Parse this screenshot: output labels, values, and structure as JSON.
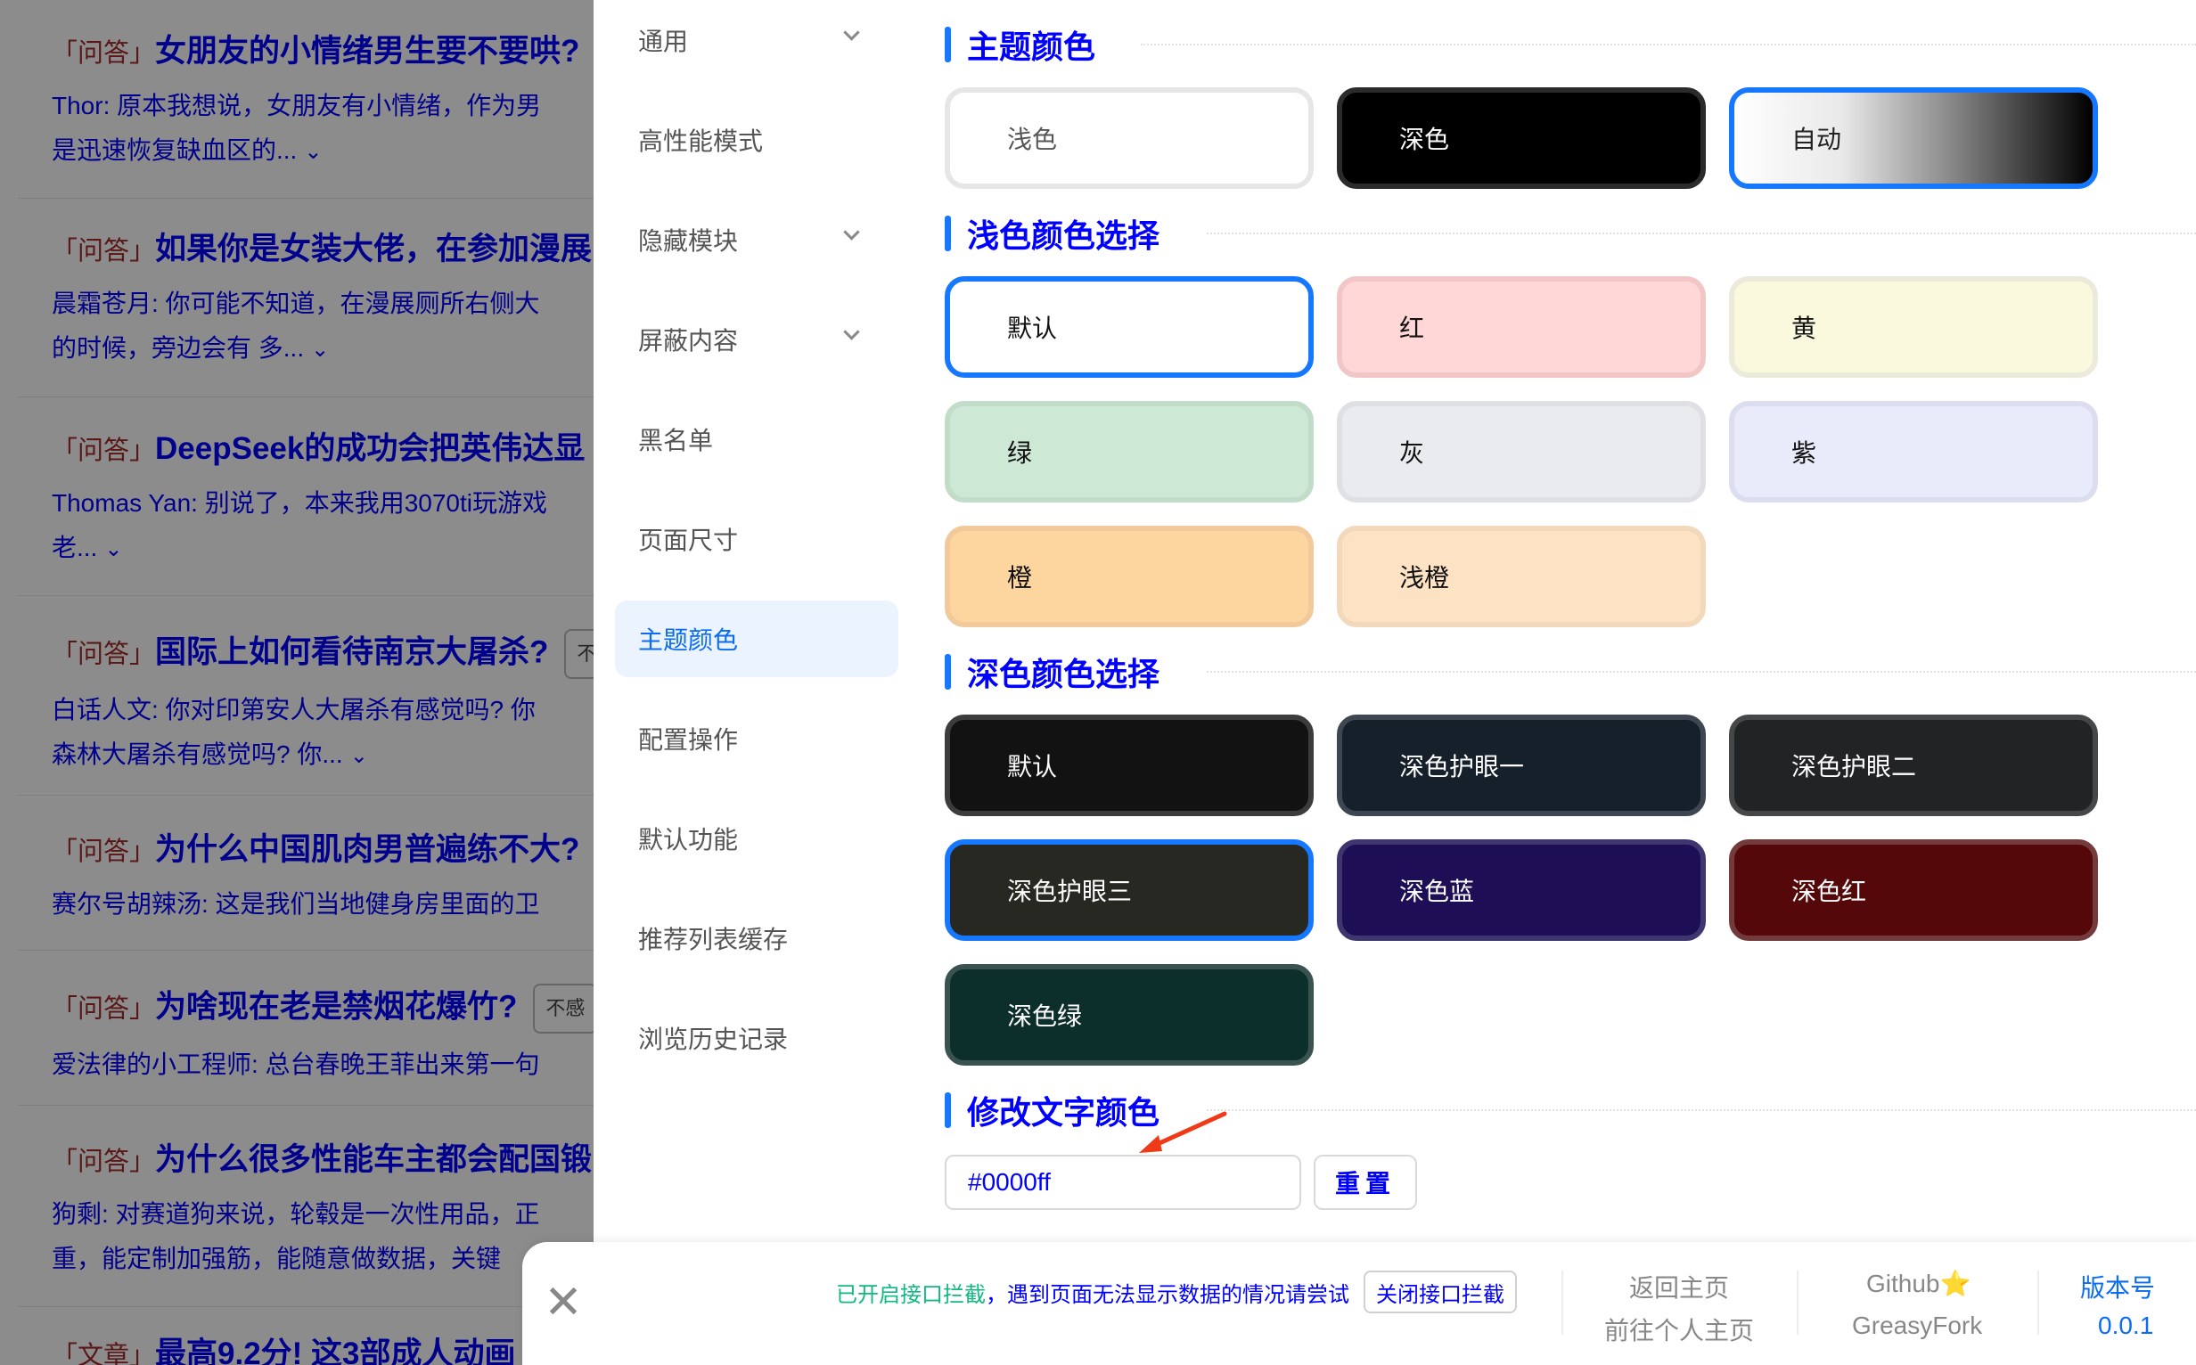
{
  "feed": [
    {
      "tag": "「问答」",
      "title": "女朋友的小情绪男生要不要哄?",
      "excerpt_1": "Thor: 原本我想说，女朋友有小情绪，作为男",
      "excerpt_2": "是迅速恢复缺血区的...",
      "badge": ""
    },
    {
      "tag": "「问答」",
      "title": "如果你是女装大佬，在参加漫展",
      "excerpt_1": "晨霜苍月: 你可能不知道，在漫展厕所右侧大",
      "excerpt_2": "的时候，旁边会有 多...",
      "badge": ""
    },
    {
      "tag": "「问答」",
      "title": "DeepSeek的成功会把英伟达显",
      "excerpt_1": "Thomas Yan: 别说了，本来我用3070ti玩游戏",
      "excerpt_2": "老...",
      "badge": ""
    },
    {
      "tag": "「问答」",
      "title": "国际上如何看待南京大屠杀?",
      "excerpt_1": "白话人文: 你对印第安人大屠杀有感觉吗? 你",
      "excerpt_2": "森林大屠杀有感觉吗? 你...",
      "badge": "不"
    },
    {
      "tag": "「问答」",
      "title": "为什么中国肌肉男普遍练不大?",
      "excerpt_1": "赛尔号胡辣汤: 这是我们当地健身房里面的卫",
      "excerpt_2": "",
      "badge": ""
    },
    {
      "tag": "「问答」",
      "title": "为啥现在老是禁烟花爆竹?",
      "excerpt_1": "爱法律的小工程师: 总台春晚王菲出来第一句",
      "excerpt_2": "",
      "badge": "不感"
    },
    {
      "tag": "「问答」",
      "title": "为什么很多性能车主都会配国锻",
      "excerpt_1": "狗剩: 对赛道狗来说，轮毂是一次性用品，正",
      "excerpt_2": "重，能定制加强筋，能随意做数据，关键",
      "badge": ""
    },
    {
      "tag": "「文章」",
      "title": "最高9.2分! 这3部成人动画",
      "excerpt_1": "",
      "excerpt_2": "",
      "badge": ""
    }
  ],
  "menu": [
    {
      "label": "通用",
      "has_caret": true
    },
    {
      "label": "高性能模式",
      "has_caret": false
    },
    {
      "label": "隐藏模块",
      "has_caret": true
    },
    {
      "label": "屏蔽内容",
      "has_caret": true
    },
    {
      "label": "黑名单",
      "has_caret": false
    },
    {
      "label": "页面尺寸",
      "has_caret": false
    },
    {
      "label": "主题颜色",
      "has_caret": false,
      "active": true
    },
    {
      "label": "配置操作",
      "has_caret": false
    },
    {
      "label": "默认功能",
      "has_caret": false
    },
    {
      "label": "推荐列表缓存",
      "has_caret": false
    },
    {
      "label": "浏览历史记录",
      "has_caret": false
    }
  ],
  "sections": {
    "theme": "主题颜色",
    "light": "浅色颜色选择",
    "dark": "深色颜色选择",
    "text": "修改文字颜色"
  },
  "theme_options": [
    {
      "label": "浅色",
      "bg": "#ffffff",
      "text": "#555555"
    },
    {
      "label": "深色",
      "bg": "#000000",
      "text": "#ffffff"
    },
    {
      "label": "自动",
      "bg": "gradient",
      "text": "#222222",
      "selected": true
    }
  ],
  "light_options": [
    {
      "label": "默认",
      "bg": "#ffffff",
      "border": "#1677ff",
      "selected": true
    },
    {
      "label": "红",
      "bg": "#ffd7d7",
      "border": "#f2c6c6"
    },
    {
      "label": "黄",
      "bg": "#faf8dd",
      "border": "#eceadb"
    },
    {
      "label": "绿",
      "bg": "#cde8d5",
      "border": "#c1dcc8"
    },
    {
      "label": "灰",
      "bg": "#eaebee",
      "border": "#dfe0e3"
    },
    {
      "label": "紫",
      "bg": "#e9ebfb",
      "border": "#dcdef0"
    },
    {
      "label": "橙",
      "bg": "#fdd59f",
      "border": "#f1c99a"
    },
    {
      "label": "浅橙",
      "bg": "#fde3c3",
      "border": "#f2d9bc"
    }
  ],
  "dark_options": [
    {
      "label": "默认",
      "bg": "#121212",
      "border": "#3c3c3c"
    },
    {
      "label": "深色护眼一",
      "bg": "#15202b",
      "border": "#3d4651"
    },
    {
      "label": "深色护眼二",
      "bg": "#212325",
      "border": "#454749"
    },
    {
      "label": "深色护眼三",
      "bg": "#272822",
      "border": "#1677ff",
      "selected": true
    },
    {
      "label": "深色蓝",
      "bg": "#1d0e56",
      "border": "#40366f"
    },
    {
      "label": "深色红",
      "bg": "#55080a",
      "border": "#733b3c"
    },
    {
      "label": "深色绿",
      "bg": "#0d2f2c",
      "border": "#3b5350"
    }
  ],
  "text_color": {
    "value": "#0000ff",
    "reset_label": "重置"
  },
  "footer": {
    "notice_green": "已开启接口拦截",
    "notice_blue": "，遇到页面无法显示数据的情况请尝试",
    "intercept_button": "关闭接口拦截",
    "home": "返回主页",
    "profile": "前往个人主页",
    "github": "Github⭐",
    "greasyfork": "GreasyFork",
    "version_label": "版本号",
    "version": "0.0.1",
    "close": "✕"
  },
  "colors": {
    "accent": "#1677ff",
    "text_custom": "#0000ff",
    "annotation_arrow": "#f03a17"
  }
}
